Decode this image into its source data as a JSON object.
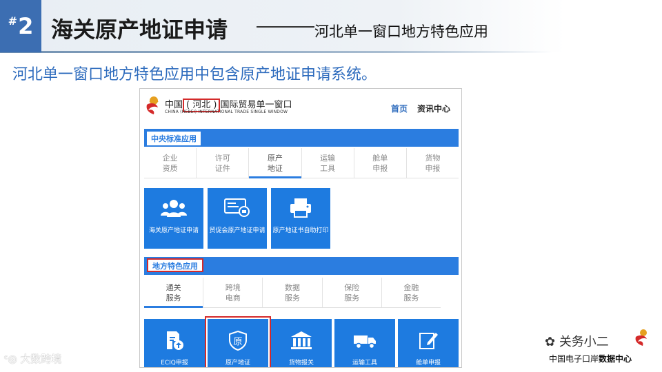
{
  "slide": {
    "number_prefix": "#",
    "number": "2",
    "title": "海关原产地证申请",
    "subtitle": "河北单一窗口地方特色应用",
    "intro": "河北单一窗口地方特色应用中包含原产地证申请系统。"
  },
  "portal": {
    "title_prefix": "中国",
    "title_region": "( 河北 )",
    "title_suffix": "国际贸易单一窗口",
    "subtitle": "CHINA (HEBEI)  INTERNATIONAL TRADE SINGLE WINDOW",
    "nav": {
      "home": "首页",
      "news": "资讯中心"
    },
    "central_section": "中央标准应用",
    "central_tabs": [
      {
        "line1": "企业",
        "line2": "资质"
      },
      {
        "line1": "许可",
        "line2": "证件"
      },
      {
        "line1": "原产",
        "line2": "地证"
      },
      {
        "line1": "运输",
        "line2": "工具"
      },
      {
        "line1": "舱单",
        "line2": "申报"
      },
      {
        "line1": "货物",
        "line2": "申报"
      }
    ],
    "central_tiles": [
      {
        "label": "海关原产地证申请",
        "icon": "group-users-icon"
      },
      {
        "label": "贸促会原产地证申请",
        "icon": "certificate-card-icon"
      },
      {
        "label": "原产地证书自助打印",
        "icon": "printer-icon"
      }
    ],
    "local_section": "地方特色应用",
    "local_tabs": [
      {
        "line1": "通关",
        "line2": "服务"
      },
      {
        "line1": "跨境",
        "line2": "电商"
      },
      {
        "line1": "数据",
        "line2": "服务"
      },
      {
        "line1": "保险",
        "line2": "服务"
      },
      {
        "line1": "金融",
        "line2": "服务"
      }
    ],
    "local_tiles": [
      {
        "label": "ECIQ申报",
        "icon": "document-upload-icon"
      },
      {
        "label": "原产地证",
        "icon": "origin-shield-icon",
        "glyph": "原"
      },
      {
        "label": "货物报关",
        "icon": "customs-building-icon"
      },
      {
        "label": "运输工具",
        "icon": "truck-icon"
      },
      {
        "label": "舱单申报",
        "icon": "edit-form-icon"
      }
    ]
  },
  "watermarks": {
    "left": "大数跨境",
    "right_name": "关务小二",
    "right_caption_a": "中国电子口岸",
    "right_caption_b": "数据中心"
  },
  "colors": {
    "accent": "#2b7de0",
    "highlight": "#d42a2a",
    "badge": "#3c6eb2",
    "intro_text": "#2d6bbd"
  }
}
